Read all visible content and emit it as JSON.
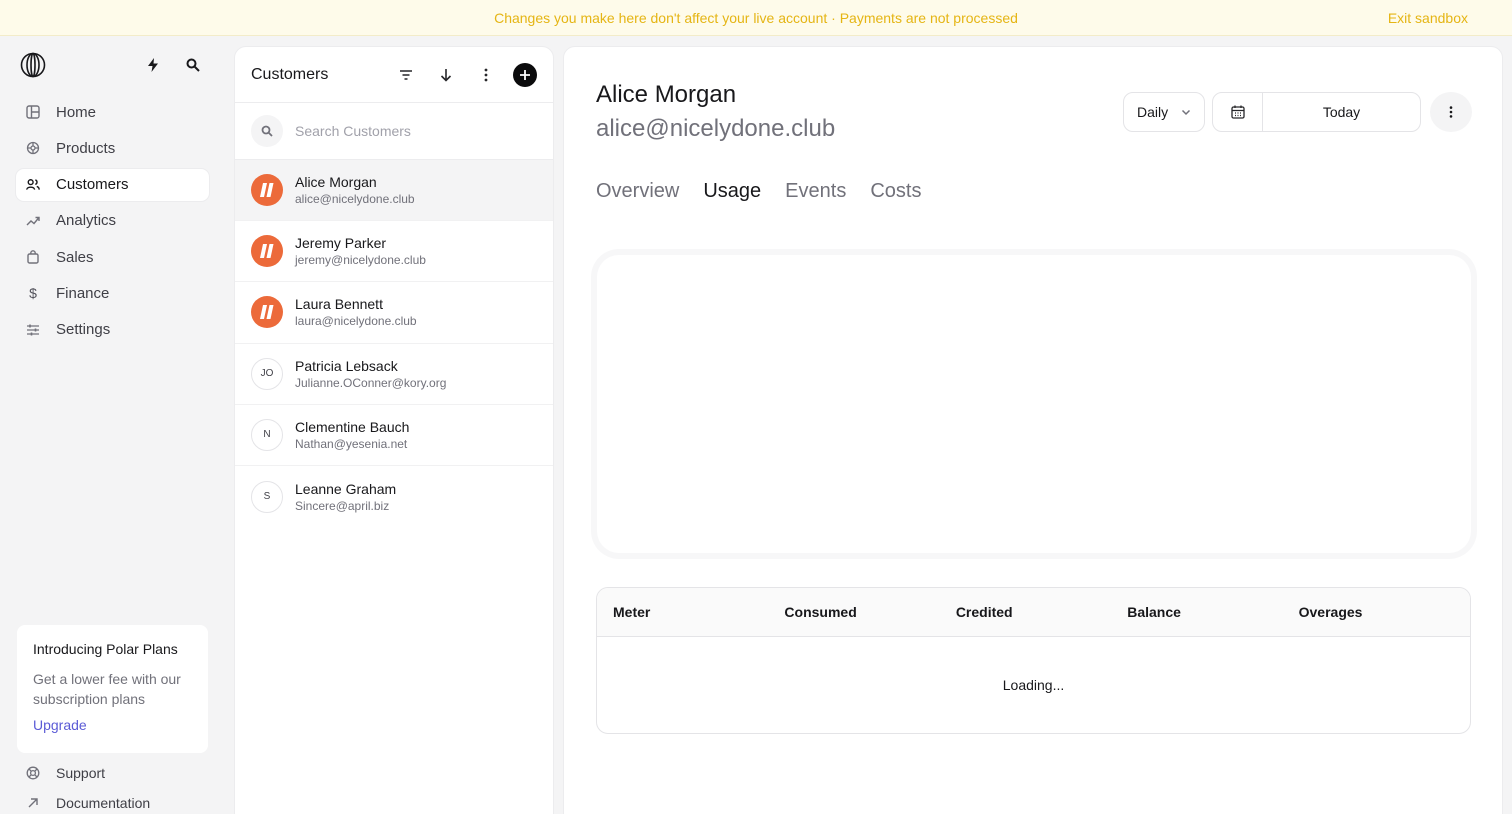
{
  "banner": {
    "message": "Changes you make here don't affect your live account · Payments are not processed",
    "exit_label": "Exit sandbox"
  },
  "sidebar": {
    "items": [
      {
        "label": "Home",
        "icon": "home-icon"
      },
      {
        "label": "Products",
        "icon": "products-icon"
      },
      {
        "label": "Customers",
        "icon": "users-icon",
        "active": true
      },
      {
        "label": "Analytics",
        "icon": "trend-icon"
      },
      {
        "label": "Sales",
        "icon": "bag-icon"
      },
      {
        "label": "Finance",
        "icon": "dollar-icon"
      },
      {
        "label": "Settings",
        "icon": "sliders-icon"
      }
    ],
    "promo": {
      "title": "Introducing Polar Plans",
      "description": "Get a lower fee with our subscription plans",
      "cta": "Upgrade"
    },
    "footer": [
      {
        "label": "Support",
        "icon": "support-icon"
      },
      {
        "label": "Documentation",
        "icon": "arrow-up-right-icon"
      }
    ]
  },
  "customers_panel": {
    "title": "Customers",
    "search_placeholder": "Search Customers",
    "customers": [
      {
        "name": "Alice Morgan",
        "email": "alice@nicelydone.club",
        "avatar": "logo",
        "selected": true
      },
      {
        "name": "Jeremy Parker",
        "email": "jeremy@nicelydone.club",
        "avatar": "logo"
      },
      {
        "name": "Laura Bennett",
        "email": "laura@nicelydone.club",
        "avatar": "logo"
      },
      {
        "name": "Patricia Lebsack",
        "email": "Julianne.OConner@kory.org",
        "initials": "JO"
      },
      {
        "name": "Clementine Bauch",
        "email": "Nathan@yesenia.net",
        "initials": "N"
      },
      {
        "name": "Leanne Graham",
        "email": "Sincere@april.biz",
        "initials": "S"
      }
    ]
  },
  "detail": {
    "name": "Alice Morgan",
    "email": "alice@nicelydone.club",
    "interval": "Daily",
    "date_label": "Today",
    "tabs": [
      {
        "label": "Overview"
      },
      {
        "label": "Usage",
        "active": true
      },
      {
        "label": "Events"
      },
      {
        "label": "Costs"
      }
    ],
    "table": {
      "columns": [
        "Meter",
        "Consumed",
        "Credited",
        "Balance",
        "Overages"
      ],
      "status": "Loading..."
    }
  },
  "colors": {
    "banner_bg": "#fefbea",
    "banner_text": "#e5b514",
    "avatar_orange": "#ec6a3a",
    "upgrade_link": "#5b5bd6"
  }
}
